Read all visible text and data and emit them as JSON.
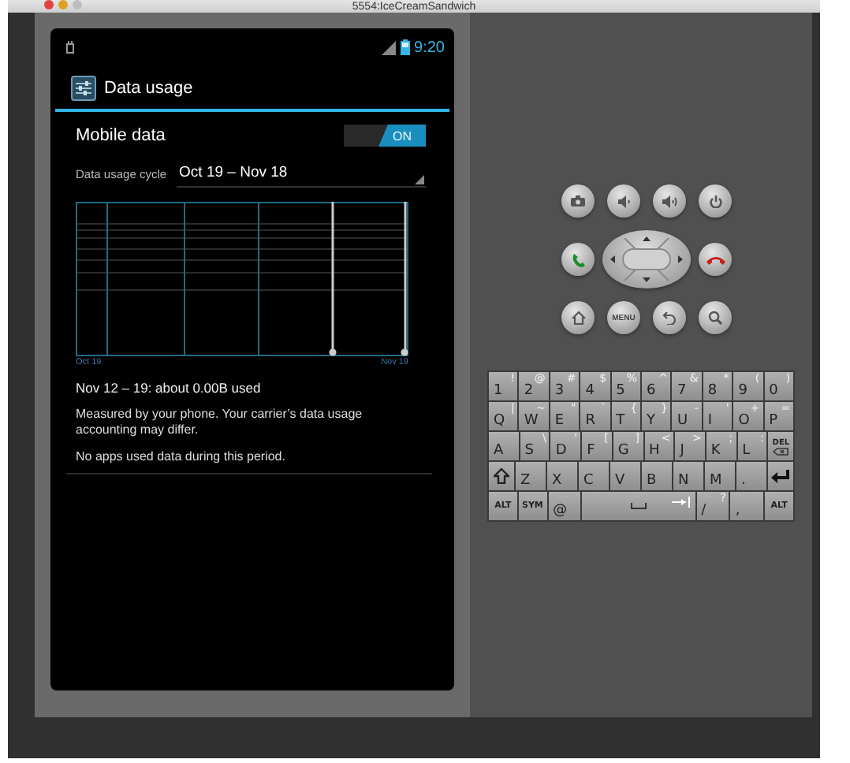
{
  "window": {
    "title": "5554:IceCreamSandwich"
  },
  "status_bar": {
    "time": "9:20"
  },
  "action_bar": {
    "title": "Data usage"
  },
  "mobile_data": {
    "label": "Mobile data",
    "on": true,
    "switch_text": "ON"
  },
  "cycle": {
    "label": "Data usage cycle",
    "value": "Oct 19 – Nov 18"
  },
  "chart": {
    "start_label": "Oct 19",
    "end_label": "Nov 19"
  },
  "summary": "Nov 12 – 19: about 0.00B used",
  "note": "Measured by your phone. Your carrier’s data usage accounting may differ.",
  "empty_message": "No apps used data during this period.",
  "hardware_buttons": {
    "menu_label": "MENU"
  },
  "keyboard": {
    "rows": [
      {
        "keys": [
          {
            "kind": "char",
            "main": "1",
            "alt": "!"
          },
          {
            "kind": "char",
            "main": "2",
            "alt": "@"
          },
          {
            "kind": "char",
            "main": "3",
            "alt": "#"
          },
          {
            "kind": "char",
            "main": "4",
            "alt": "$"
          },
          {
            "kind": "char",
            "main": "5",
            "alt": "%"
          },
          {
            "kind": "char",
            "main": "6",
            "alt": "^"
          },
          {
            "kind": "char",
            "main": "7",
            "alt": "&"
          },
          {
            "kind": "char",
            "main": "8",
            "alt": "*"
          },
          {
            "kind": "char",
            "main": "9",
            "alt": "("
          },
          {
            "kind": "char",
            "main": "0",
            "alt": ")"
          }
        ]
      },
      {
        "keys": [
          {
            "kind": "char",
            "main": "Q",
            "alt": "|"
          },
          {
            "kind": "char",
            "main": "W",
            "alt": "~"
          },
          {
            "kind": "char",
            "main": "E",
            "alt": "\""
          },
          {
            "kind": "char",
            "main": "R",
            "alt": "`"
          },
          {
            "kind": "char",
            "main": "T",
            "alt": "{"
          },
          {
            "kind": "char",
            "main": "Y",
            "alt": "}"
          },
          {
            "kind": "char",
            "main": "U",
            "alt": "-"
          },
          {
            "kind": "char",
            "main": "I",
            "alt": "'"
          },
          {
            "kind": "char",
            "main": "O",
            "alt": "+"
          },
          {
            "kind": "char",
            "main": "P",
            "alt": "="
          }
        ]
      },
      {
        "keys": [
          {
            "kind": "char",
            "main": "A"
          },
          {
            "kind": "char",
            "main": "S",
            "alt": "\\"
          },
          {
            "kind": "char",
            "main": "D",
            "alt": "'"
          },
          {
            "kind": "char",
            "main": "F",
            "alt": "["
          },
          {
            "kind": "char",
            "main": "G",
            "alt": "]"
          },
          {
            "kind": "char",
            "main": "H",
            "alt": "<"
          },
          {
            "kind": "char",
            "main": "J",
            "alt": ">"
          },
          {
            "kind": "char",
            "main": "K",
            "alt": ";"
          },
          {
            "kind": "char",
            "main": "L",
            "alt": ":"
          },
          {
            "kind": "del",
            "main": "DEL"
          }
        ]
      },
      {
        "keys": [
          {
            "kind": "shift"
          },
          {
            "kind": "char",
            "main": "Z"
          },
          {
            "kind": "char",
            "main": "X"
          },
          {
            "kind": "char",
            "main": "C"
          },
          {
            "kind": "char",
            "main": "V"
          },
          {
            "kind": "char",
            "main": "B"
          },
          {
            "kind": "char",
            "main": "N"
          },
          {
            "kind": "char",
            "main": "M"
          },
          {
            "kind": "char",
            "main": "."
          },
          {
            "kind": "enter"
          }
        ]
      },
      {
        "keys": [
          {
            "kind": "label",
            "main": "ALT"
          },
          {
            "kind": "label",
            "main": "SYM"
          },
          {
            "kind": "char",
            "main": "@"
          },
          {
            "kind": "space"
          },
          {
            "kind": "char",
            "main": "/",
            "alt": "?"
          },
          {
            "kind": "char",
            "main": ","
          },
          {
            "kind": "label",
            "main": "ALT"
          }
        ]
      }
    ]
  }
}
